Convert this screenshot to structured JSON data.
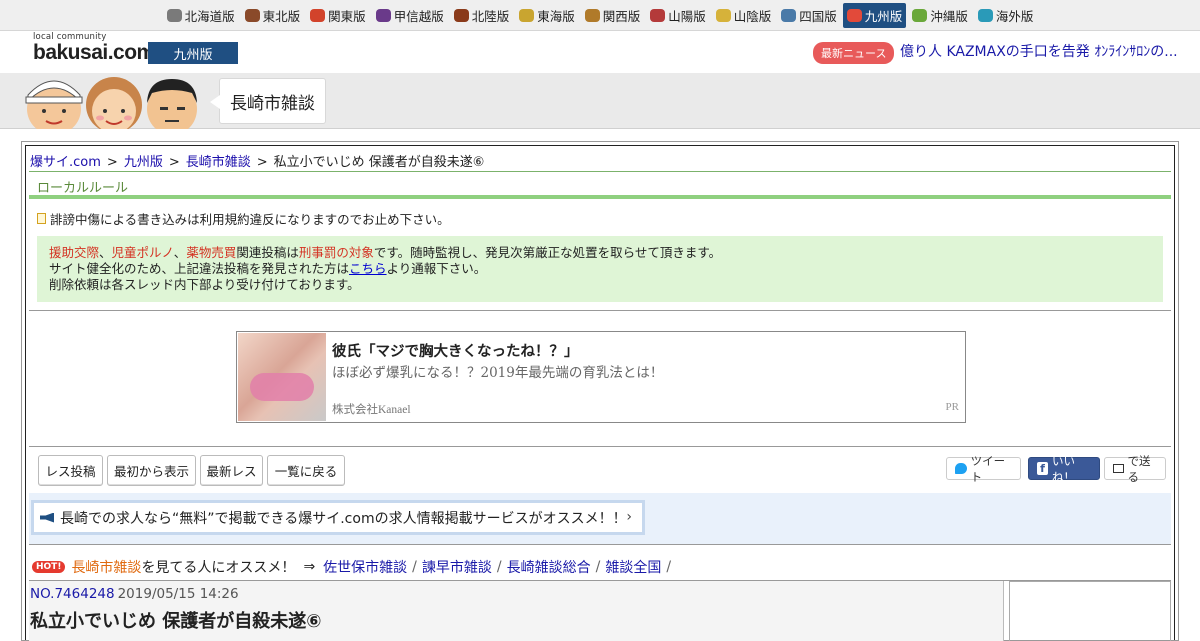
{
  "regions": [
    {
      "label": "北海道版",
      "icon": "hokkaido-icon",
      "color": "#7a7a7a",
      "active": false
    },
    {
      "label": "東北版",
      "icon": "tohoku-icon",
      "color": "#8a4a2a",
      "active": false
    },
    {
      "label": "関東版",
      "icon": "kanto-icon",
      "color": "#d2432b",
      "active": false
    },
    {
      "label": "甲信越版",
      "icon": "koshinetsu-icon",
      "color": "#6a3a8a",
      "active": false
    },
    {
      "label": "北陸版",
      "icon": "hokuriku-icon",
      "color": "#8a3a1a",
      "active": false
    },
    {
      "label": "東海版",
      "icon": "tokai-icon",
      "color": "#c9a530",
      "active": false
    },
    {
      "label": "関西版",
      "icon": "kansai-icon",
      "color": "#b07a2a",
      "active": false
    },
    {
      "label": "山陽版",
      "icon": "sanyo-icon",
      "color": "#b43a3a",
      "active": false
    },
    {
      "label": "山陰版",
      "icon": "sanin-icon",
      "color": "#d6b23a",
      "active": false
    },
    {
      "label": "四国版",
      "icon": "shikoku-icon",
      "color": "#4a7aa8",
      "active": false
    },
    {
      "label": "九州版",
      "icon": "kyushu-icon",
      "color": "#e24a3a",
      "active": true
    },
    {
      "label": "沖縄版",
      "icon": "okinawa-icon",
      "color": "#6aa83a",
      "active": false
    },
    {
      "label": "海外版",
      "icon": "overseas-icon",
      "color": "#2a9ab8",
      "active": false
    }
  ],
  "header": {
    "logo_small": "local community",
    "logo_big": "bakusai.com",
    "edition": "九州版",
    "news_badge": "最新ニュース",
    "news_text": "億り人 KAZMAXの手口を告発 ｵﾝﾗｲﾝｻﾛﾝの..."
  },
  "banner": {
    "board_title": "長崎市雑談"
  },
  "breadcrumb": {
    "items": [
      "爆サイ.com",
      "九州版",
      "長崎市雑談"
    ],
    "current": "私立小でいじめ 保護者が自殺未遂⑥",
    "sep": ">"
  },
  "rules": {
    "heading": "ローカルルール",
    "warning": "誹謗中傷による書き込みは利用規約違反になりますのでお止め下さい。",
    "notice": {
      "red1": "援助交際",
      "red2": "児童ポルノ",
      "red3": "薬物売買",
      "mid1": "関連投稿は",
      "red4": "刑事罰の対象",
      "mid2": "です。随時監視し、発見次第厳正な処置を取らせて頂きます。",
      "line2_pre": "サイト健全化のため、上記違法投稿を発見された方は",
      "line2_link": "こちら",
      "line2_post": "より通報下さい。",
      "line3": "削除依頼は各スレッド内下部より受け付けております。"
    }
  },
  "ad": {
    "title": "彼氏「マジで胸大きくなったね！？」",
    "subtitle": "ほぼ必ず爆乳になる！？2019年最先端の育乳法とは！",
    "sponsor": "株式会社Kanael",
    "pr": "PR"
  },
  "actions": {
    "reply": "レス投稿",
    "from_start": "最初から表示",
    "latest": "最新レス",
    "back": "一覧に戻る",
    "tweet": "ツイート",
    "like": "いいね！",
    "send": "で送る"
  },
  "job": {
    "text": "長崎での求人なら“無料”で掲載できる爆サイ.comの求人情報掲載サービスがオススメ！！"
  },
  "recommend": {
    "hot": "HOT!",
    "board": "長崎市雑談",
    "suffix": "を見てる人にオススメ！",
    "arrow": "⇒",
    "links": [
      "佐世保市雑談",
      "諫早市雑談",
      "長崎雑談総合",
      "雑談全国"
    ]
  },
  "post": {
    "number": "NO.7464248",
    "date": "2019/05/15 14:26",
    "title": "私立小でいじめ 保護者が自殺未遂⑥"
  }
}
